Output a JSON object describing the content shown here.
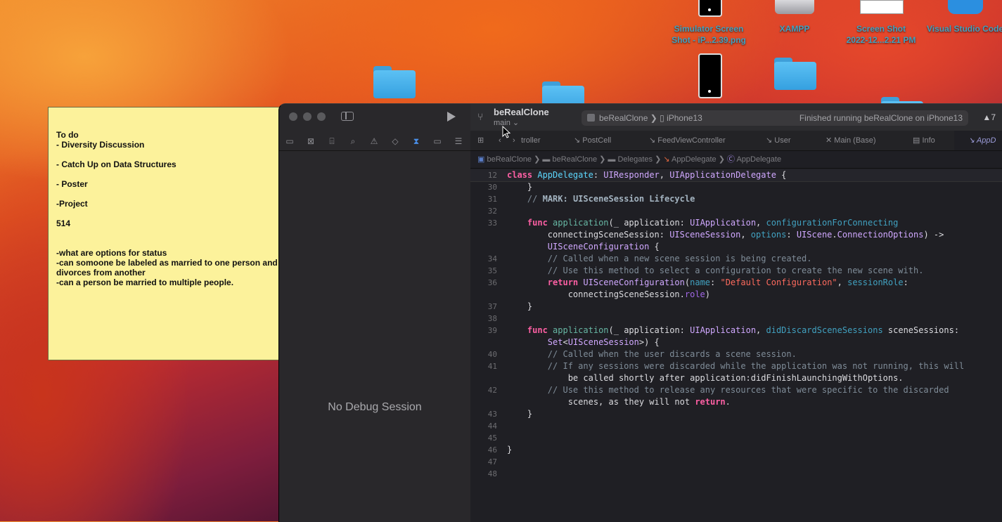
{
  "desktop": {
    "icons": [
      {
        "id": "sim-shot",
        "label_line1": "Simulator Screen",
        "label_line2": "Shot - iP...2.39.png",
        "icon": "phone-screenshot-icon"
      },
      {
        "id": "xampp",
        "label_line1": "XAMPP",
        "label_line2": "",
        "icon": "drive-icon"
      },
      {
        "id": "screenshot",
        "label_line1": "Screen Shot",
        "label_line2": "2022-12...2.21 PM",
        "icon": "screenshot-icon"
      },
      {
        "id": "vscode",
        "label_line1": "Visual Studio Code",
        "label_line2": "",
        "icon": "vscode-icon"
      }
    ]
  },
  "sticky": {
    "lines": [
      "To do",
      "- Diversity Discussion",
      "",
      "- Catch Up on Data Structures",
      "",
      "- Poster",
      "",
      "-Project",
      "",
      "514",
      "",
      "",
      "-what are options for status",
      "-can somoone be labeled as married to one person and",
      "divorces from another",
      "-can a person be married to multiple people."
    ]
  },
  "xcode": {
    "project_name": "beRealClone",
    "branch": "main",
    "scheme": {
      "project": "beRealClone",
      "device": "iPhone13",
      "status": "Finished running beRealClone on iPhone13"
    },
    "warnings": "7",
    "debug_message": "No Debug Session",
    "tabs": [
      {
        "label": "troller"
      },
      {
        "label": "PostCell"
      },
      {
        "label": "FeedViewController"
      },
      {
        "label": "User"
      },
      {
        "label": "Main (Base)"
      },
      {
        "label": "Info"
      },
      {
        "label": "AppD"
      }
    ],
    "breadcrumb": [
      "beRealClone",
      "beRealClone",
      "Delegates",
      "AppDelegate",
      "AppDelegate"
    ],
    "code_lines": [
      {
        "n": "12",
        "text": "class AppDelegate: UIResponder, UIApplicationDelegate {"
      },
      {
        "n": "30",
        "text": "    }"
      },
      {
        "n": "31",
        "text": "    // MARK: UISceneSession Lifecycle"
      },
      {
        "n": "32",
        "text": ""
      },
      {
        "n": "33",
        "text": "    func application(_ application: UIApplication, configurationForConnecting"
      },
      {
        "n": "",
        "text": "        connectingSceneSession: UISceneSession, options: UIScene.ConnectionOptions) ->"
      },
      {
        "n": "",
        "text": "        UISceneConfiguration {"
      },
      {
        "n": "34",
        "text": "        // Called when a new scene session is being created."
      },
      {
        "n": "35",
        "text": "        // Use this method to select a configuration to create the new scene with."
      },
      {
        "n": "36",
        "text": "        return UISceneConfiguration(name: \"Default Configuration\", sessionRole:"
      },
      {
        "n": "",
        "text": "            connectingSceneSession.role)"
      },
      {
        "n": "37",
        "text": "    }"
      },
      {
        "n": "38",
        "text": ""
      },
      {
        "n": "39",
        "text": "    func application(_ application: UIApplication, didDiscardSceneSessions sceneSessions:"
      },
      {
        "n": "",
        "text": "        Set<UISceneSession>) {"
      },
      {
        "n": "40",
        "text": "        // Called when the user discards a scene session."
      },
      {
        "n": "41",
        "text": "        // If any sessions were discarded while the application was not running, this will"
      },
      {
        "n": "",
        "text": "            be called shortly after application:didFinishLaunchingWithOptions."
      },
      {
        "n": "42",
        "text": "        // Use this method to release any resources that were specific to the discarded"
      },
      {
        "n": "",
        "text": "            scenes, as they will not return."
      },
      {
        "n": "43",
        "text": "    }"
      },
      {
        "n": "44",
        "text": ""
      },
      {
        "n": "45",
        "text": ""
      },
      {
        "n": "46",
        "text": "}"
      },
      {
        "n": "47",
        "text": ""
      },
      {
        "n": "48",
        "text": ""
      }
    ]
  }
}
